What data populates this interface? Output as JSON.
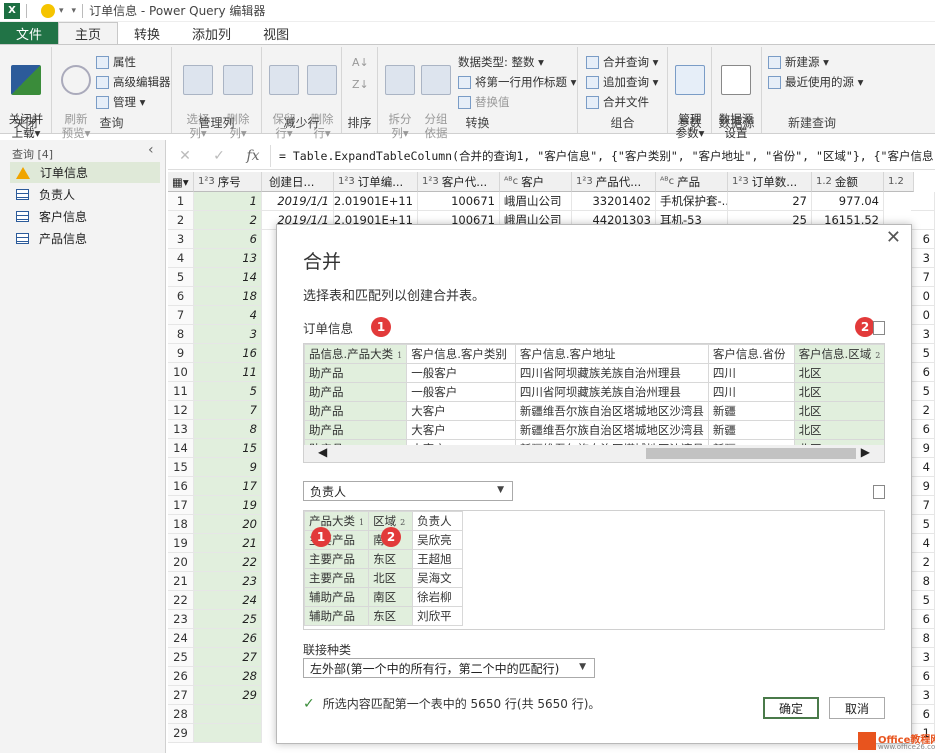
{
  "titlebar": {
    "title": "订单信息 - Power Query 编辑器",
    "excel_logo": "X"
  },
  "tabs": [
    "文件",
    "主页",
    "转换",
    "添加列",
    "视图"
  ],
  "ribbon": {
    "groups": {
      "close": {
        "label": "关闭",
        "btn": "关闭并\n上载▾"
      },
      "query": {
        "label": "查询",
        "refresh": "刷新\n预览▾",
        "properties": "属性",
        "advanced_editor": "高级编辑器",
        "manage": "管理 ▾"
      },
      "manage_cols": {
        "label": "管理列",
        "choose": "选择\n列▾",
        "remove": "删除\n列▾"
      },
      "reduce_rows": {
        "label": "减少行",
        "keep": "保留\n行▾",
        "remove": "删除\n行▾"
      },
      "sort": {
        "label": "排序"
      },
      "transform": {
        "label": "转换",
        "split": "拆分\n列▾",
        "group": "分组\n依据",
        "data_type": "数据类型: 整数 ▾",
        "first_row_header": "将第一行用作标题 ▾",
        "replace": "替换值"
      },
      "combine": {
        "label": "组合",
        "merge": "合并查询 ▾",
        "append": "追加查询 ▾",
        "combine_files": "合并文件"
      },
      "params": {
        "label": "参数",
        "manage": "管理\n参数▾"
      },
      "datasource": {
        "label": "数据源",
        "settings": "数据源\n设置"
      },
      "newquery": {
        "label": "新建查询",
        "new_source": "新建源 ▾",
        "recent": "最近使用的源 ▾"
      }
    }
  },
  "leftpane": {
    "header": "查询 [4]",
    "items": [
      "订单信息",
      "负责人",
      "客户信息",
      "产品信息"
    ]
  },
  "formula": {
    "cancel": "✕",
    "confirm": "✓",
    "fx": "fx",
    "text": "= Table.ExpandTableColumn(合并的查询1, \"客户信息\", {\"客户类别\", \"客户地址\", \"省份\", \"区域\"}, {\"客户信息.客户类别\","
  },
  "grid": {
    "headers": [
      {
        "type": "1²3",
        "name": "序号"
      },
      {
        "type": "",
        "name": "创建日..."
      },
      {
        "type": "1²3",
        "name": "订单编..."
      },
      {
        "type": "1²3",
        "name": "客户代..."
      },
      {
        "type": "ᴬᴮc",
        "name": "客户"
      },
      {
        "type": "1²3",
        "name": "产品代..."
      },
      {
        "type": "ᴬᴮc",
        "name": "产品"
      },
      {
        "type": "1²3",
        "name": "订单数..."
      },
      {
        "type": "1.2",
        "name": "金额"
      },
      {
        "type": "1.2",
        "name": ""
      }
    ],
    "row_numbers": [
      "1",
      "2",
      "3",
      "4",
      "5",
      "6",
      "7",
      "8",
      "9",
      "10",
      "11",
      "12",
      "13",
      "14",
      "15",
      "16",
      "17",
      "18",
      "19",
      "20",
      "21",
      "22",
      "23",
      "24",
      "25",
      "26",
      "27",
      "28",
      "29"
    ],
    "seq_values": [
      "1",
      "2",
      "6",
      "13",
      "14",
      "18",
      "4",
      "3",
      "16",
      "11",
      "5",
      "7",
      "8",
      "15",
      "9",
      "17",
      "19",
      "20",
      "21",
      "22",
      "23",
      "24",
      "25",
      "26",
      "27",
      "28",
      "29",
      "",
      ""
    ],
    "right_edge": [
      "",
      "",
      "6",
      "3",
      "7",
      "0",
      "0",
      "3",
      "5",
      "6",
      "5",
      "2",
      "6",
      "9",
      "4",
      "9",
      "7",
      "5",
      "4",
      "2",
      "8",
      "5",
      "6",
      "8",
      "3",
      "6",
      "3",
      "6",
      "1"
    ],
    "row1": [
      "2019/1/1",
      "2.01901E+11",
      "100671",
      "峨眉山公司",
      "33201402",
      "手机保护套-...",
      "27",
      "977.04"
    ],
    "row2": [
      "2019/1/1",
      "2.01901E+11",
      "100671",
      "峨眉山公司",
      "44201303",
      "耳机-53",
      "25",
      "16151.52"
    ]
  },
  "dialog": {
    "title": "合并",
    "subtitle": "选择表和匹配列以创建合并表。",
    "table1_label": "订单信息",
    "badge1": "1",
    "badge2": "2",
    "table1": {
      "headers": [
        "品信息.产品大类",
        "客户信息.客户类别",
        "客户信息.客户地址",
        "客户信息.省份",
        "客户信息.区域"
      ],
      "header_marks": [
        "1",
        "",
        "",
        "",
        "2"
      ],
      "rows": [
        [
          "助产品",
          "一般客户",
          "四川省阿坝藏族羌族自治州理县",
          "四川",
          "北区"
        ],
        [
          "助产品",
          "一般客户",
          "四川省阿坝藏族羌族自治州理县",
          "四川",
          "北区"
        ],
        [
          "助产品",
          "大客户",
          "新疆维吾尔族自治区塔城地区沙湾县",
          "新疆",
          "北区"
        ],
        [
          "助产品",
          "大客户",
          "新疆维吾尔族自治区塔城地区沙湾县",
          "新疆",
          "北区"
        ],
        [
          "助产品",
          "大客户",
          "新疆维吾尔族自治区塔城地区沙湾县",
          "新疆",
          "北区"
        ]
      ]
    },
    "table2_select": "负责人",
    "table2": {
      "headers": [
        "产品大类",
        "区域",
        "负责人"
      ],
      "header_marks": [
        "1",
        "2",
        ""
      ],
      "rows": [
        [
          "主要产品",
          "南区",
          "吴欣亮"
        ],
        [
          "主要产品",
          "东区",
          "王超旭"
        ],
        [
          "主要产品",
          "北区",
          "吴海文"
        ],
        [
          "辅助产品",
          "南区",
          "徐岩柳"
        ],
        [
          "辅助产品",
          "东区",
          "刘欣平"
        ]
      ]
    },
    "join_label": "联接种类",
    "join_value": "左外部(第一个中的所有行，第二个中的匹配行)",
    "status": "所选内容匹配第一个表中的 5650 行(共 5650 行)。",
    "ok": "确定",
    "cancel": "取消",
    "close": "✕"
  },
  "watermark": {
    "text": "Office教程网",
    "sub": "www.office26.com"
  },
  "colors": {
    "excel_green": "#217346",
    "highlight_green": "#e1efdd",
    "badge_red": "#e23a3a"
  }
}
